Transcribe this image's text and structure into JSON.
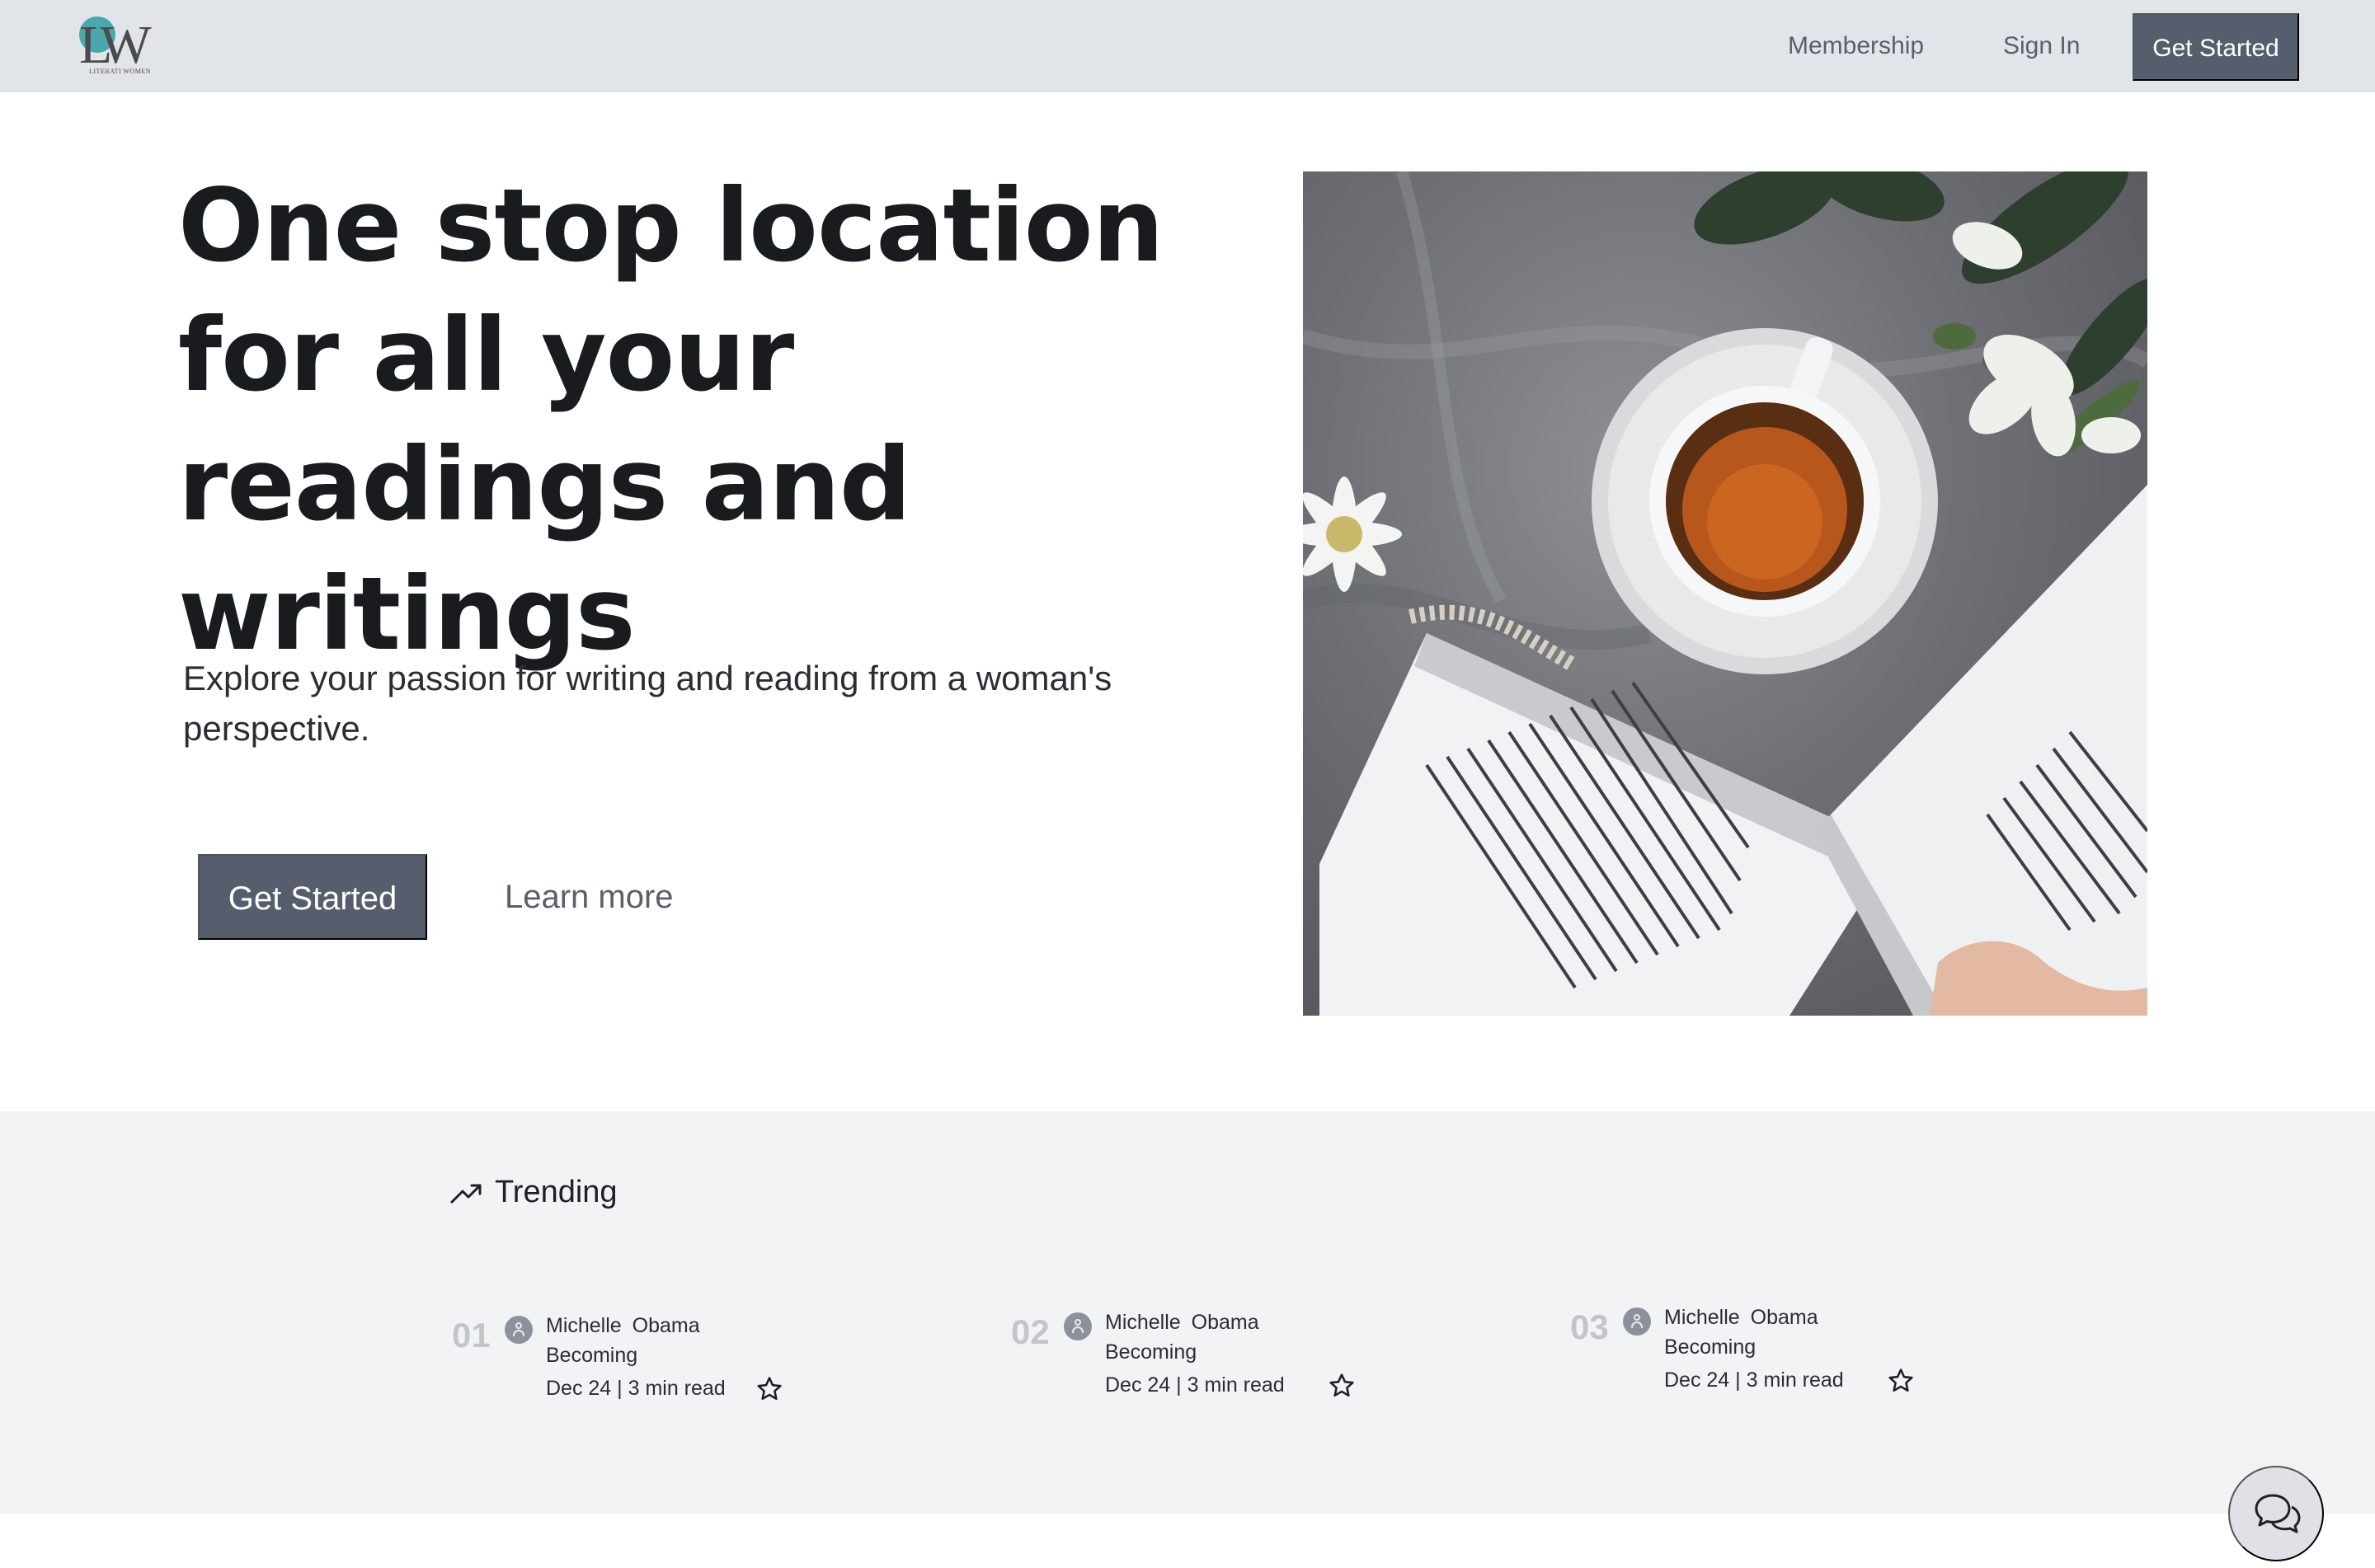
{
  "navbar": {
    "logo_letters": "LW",
    "logo_tagline": "LITERATI WOMEN",
    "links": [
      "Membership",
      "Sign In"
    ],
    "cta_label": "Get Started"
  },
  "hero": {
    "title": "One stop location for all your readings and writings",
    "subtitle": "Explore your passion for writing and reading from a woman's perspective.",
    "cta_label": "Get Started",
    "learn_more_label": "Learn more"
  },
  "trending": {
    "title": "Trending",
    "items": [
      {
        "rank": "01",
        "author": "Michelle Obama",
        "title": "Becoming",
        "meta": "Dec 24 | 3 min read"
      },
      {
        "rank": "02",
        "author": "Michelle Obama",
        "title": "Becoming",
        "meta": "Dec 24 | 3 min read"
      },
      {
        "rank": "03",
        "author": "Michelle Obama",
        "title": "Becoming",
        "meta": "Dec 24 | 3 min read"
      }
    ]
  },
  "colors": {
    "navbar_bg": "#e1e4e9",
    "button_bg": "#565d6d",
    "section_bg": "#f2f3f5",
    "rank_color": "#c2c5cc",
    "logo_accent": "#4aa8ab"
  },
  "icons": {
    "trending": "trending-up-icon",
    "bookmark": "star-icon",
    "avatar": "user-icon",
    "chat": "chat-bubbles-icon"
  }
}
